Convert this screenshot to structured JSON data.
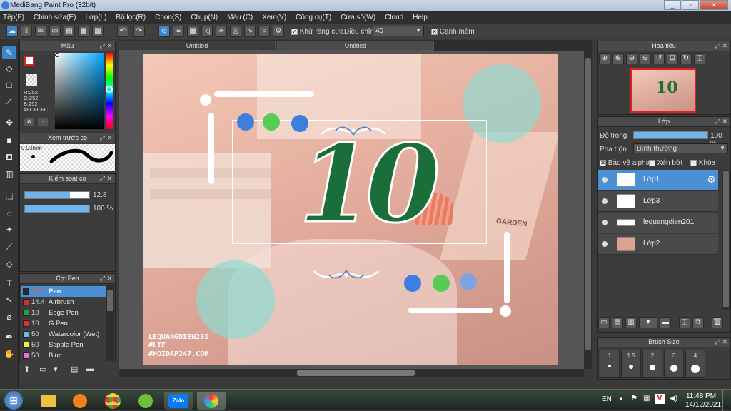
{
  "app": {
    "title": "MediBang Paint Pro (32bit)",
    "win_min": "_",
    "win_max": "▫",
    "win_close": "✕"
  },
  "menu": [
    "Tệp(F)",
    "Chỉnh sửa(E)",
    "Lớp(L)",
    "Bộ lọc(R)",
    "Chọn(S)",
    "Chụp(N)",
    "Màu (C)",
    "Xem(V)",
    "Công cụ(T)",
    "Cửa sổ(W)",
    "Cloud",
    "Help"
  ],
  "toolbar": {
    "antialias_label": "Khử răng cưa",
    "adjust_label": "Điều chỉnh",
    "adjust_value": "40",
    "soft_edge_label": "Cạnh mềm"
  },
  "color_panel": {
    "title": "Màu",
    "r": "R:252",
    "g": "G:252",
    "b": "B:252",
    "hex": "#FCFCFC"
  },
  "preview_panel": {
    "title": "Xem trước cọ",
    "size": "0.93mm"
  },
  "brush_control": {
    "title": "Kiểm soát cọ",
    "size_value": "12.8",
    "opacity_value": "100 %",
    "size_fraction": 0.7,
    "opacity_fraction": 1.0
  },
  "brush_list": {
    "title": "Cọ: Pen",
    "items": [
      {
        "size": "12.8",
        "name": "Pen",
        "color": "#2b2b2b"
      },
      {
        "size": "14.4",
        "name": "Airbrush",
        "color": "#d03030"
      },
      {
        "size": "10",
        "name": "Edge Pen",
        "color": "#20a040"
      },
      {
        "size": "10",
        "name": "G Pen",
        "color": "#e03030"
      },
      {
        "size": "50",
        "name": "Watercolor (Wet)",
        "color": "#60c0e0"
      },
      {
        "size": "50",
        "name": "Stipple Pen",
        "color": "#f0f040"
      },
      {
        "size": "50",
        "name": "Blur",
        "color": "#e070e0"
      }
    ]
  },
  "tabs": [
    "Untitled",
    "Untitled"
  ],
  "canvas": {
    "numeral": "10",
    "sig1": "LEQUANGDIEN201",
    "sig2": "#LIE",
    "sig3": "#HOIDAP247.COM",
    "book_label": "GARDEN"
  },
  "navigator": {
    "title": "Hoa tiêu"
  },
  "layers_panel": {
    "title": "Lớp",
    "opacity_label": "Độ trong",
    "opacity_value": "100 %",
    "opacity_fraction": 1.0,
    "blend_label": "Pha trộn",
    "blend_value": "Bình thường",
    "protect_alpha": "Bảo vệ alpha",
    "clip": "Xén bớt",
    "lock": "Khóa",
    "layers": [
      {
        "name": "Lớp1"
      },
      {
        "name": "Lớp3"
      },
      {
        "name": "lequangdien201"
      },
      {
        "name": "Lớp2"
      }
    ]
  },
  "brush_size": {
    "title": "Brush Size",
    "sizes": [
      "1",
      "1.5",
      "2",
      "3",
      "4"
    ]
  },
  "taskbar": {
    "lang": "EN",
    "time": "11:48 PM",
    "date": "14/12/2021",
    "zalo": "Zalo"
  }
}
